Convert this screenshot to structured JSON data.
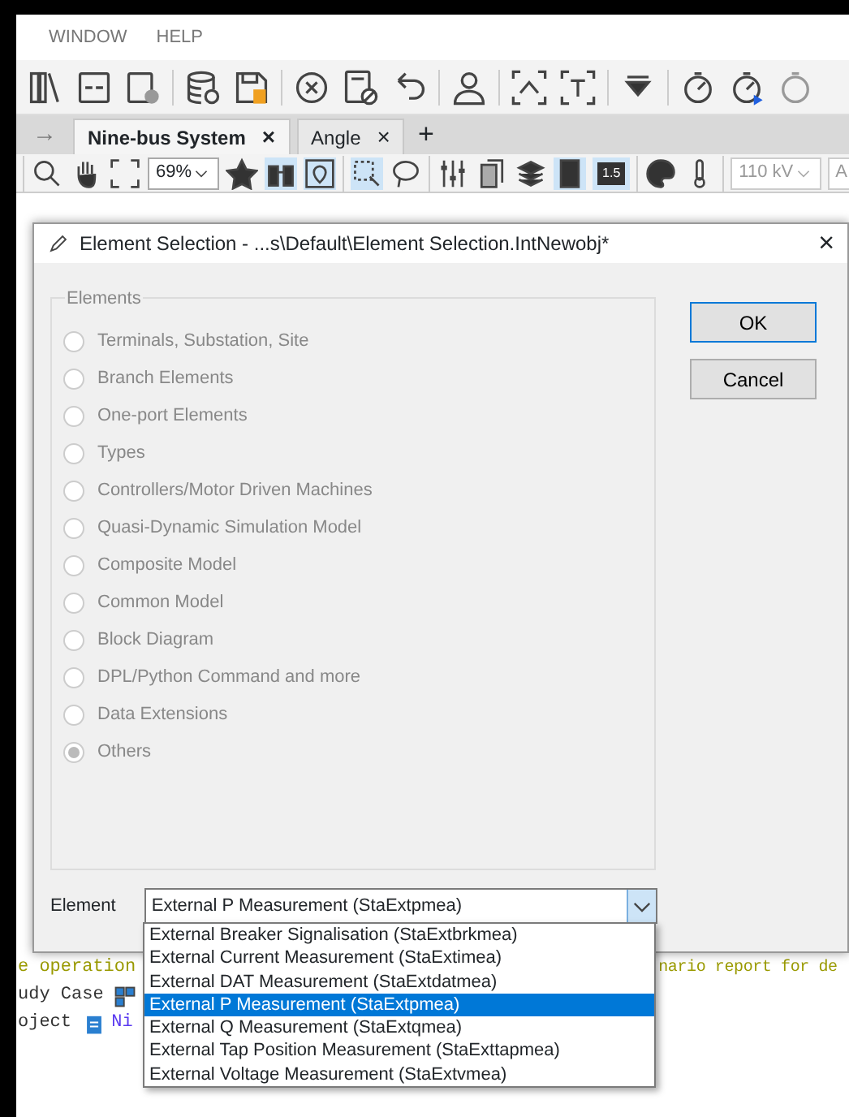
{
  "menu": [
    {
      "label": "WINDOW"
    },
    {
      "label": "HELP"
    }
  ],
  "tab_bar": {
    "back": "→",
    "tabs": [
      {
        "label": "Nine-bus System",
        "close": "×",
        "selected": true
      },
      {
        "label": "Angle",
        "close": "×",
        "selected": false
      }
    ],
    "add": "+"
  },
  "view_toolbar": {
    "zoom": "69%",
    "badge": "1.5",
    "voltage": "110 kV",
    "cut_field": "A"
  },
  "log": [
    {
      "left": "e operation",
      "right": "nario report for de",
      "kind": "warning"
    },
    {
      "left": "udy Case",
      "kind": "case"
    },
    {
      "left": "oject",
      "link": "Ni",
      "kind": "project"
    }
  ],
  "dialog": {
    "title": "Element Selection - ...s\\Default\\Element Selection.IntNewobj*",
    "close": "×",
    "group": {
      "label": "Elements",
      "options": [
        {
          "label": "Terminals, Substation, Site",
          "selected": false,
          "disabled": true
        },
        {
          "label": "Branch Elements",
          "selected": false,
          "disabled": true
        },
        {
          "label": "One-port Elements",
          "selected": false,
          "disabled": true
        },
        {
          "label": "Types",
          "selected": false,
          "disabled": true
        },
        {
          "label": "Controllers/Motor Driven Machines",
          "selected": false,
          "disabled": true
        },
        {
          "label": "Quasi-Dynamic Simulation Model",
          "selected": false,
          "disabled": true
        },
        {
          "label": "Composite Model",
          "selected": false,
          "disabled": true
        },
        {
          "label": "Common Model",
          "selected": false,
          "disabled": true
        },
        {
          "label": "Block Diagram",
          "selected": false,
          "disabled": true
        },
        {
          "label": "DPL/Python Command and more",
          "selected": false,
          "disabled": true
        },
        {
          "label": "Data Extensions",
          "selected": false,
          "disabled": true
        },
        {
          "label": "Others",
          "selected": true,
          "disabled": true
        }
      ]
    },
    "buttons": [
      "OK",
      "Cancel"
    ],
    "element": {
      "label": "Element",
      "value": "External P Measurement (StaExtpmea)",
      "options": [
        {
          "label": "External Breaker Signalisation (StaExtbrkmea)",
          "selected": false
        },
        {
          "label": "External Current Measurement (StaExtimea)",
          "selected": false
        },
        {
          "label": "External DAT Measurement (StaExtdatmea)",
          "selected": false
        },
        {
          "label": "External P Measurement (StaExtpmea)",
          "selected": true
        },
        {
          "label": "External Q Measurement (StaExtqmea)",
          "selected": false
        },
        {
          "label": "External Tap Position Measurement (StaExttapmea)",
          "selected": false
        },
        {
          "label": "External Voltage Measurement (StaExtvmea)",
          "selected": false
        }
      ]
    }
  }
}
